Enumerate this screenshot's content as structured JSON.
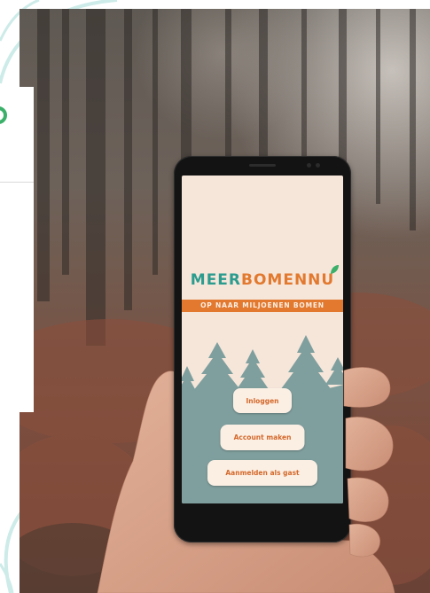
{
  "app": {
    "logo": {
      "part1": "MEER",
      "part2": "BOMENNU",
      "leaf_icon": "leaf-icon"
    },
    "tagline": "OP NAAR MILJOENEN BOMEN",
    "buttons": [
      {
        "label": "Inloggen"
      },
      {
        "label": "Account maken"
      },
      {
        "label": "Aanmelden als gast"
      }
    ]
  },
  "decor": {
    "fragment_icon": "green-curl-icon"
  },
  "colors": {
    "teal": "#2b9c8e",
    "orange": "#e2792e",
    "screen_background": "#f6e6da",
    "tree_silhouette": "#7f9f9e",
    "button_background": "#fbefe4",
    "button_text": "#d4682a",
    "decor_arc": "#cdebe8",
    "brand_fragment": "#3bb06a"
  }
}
